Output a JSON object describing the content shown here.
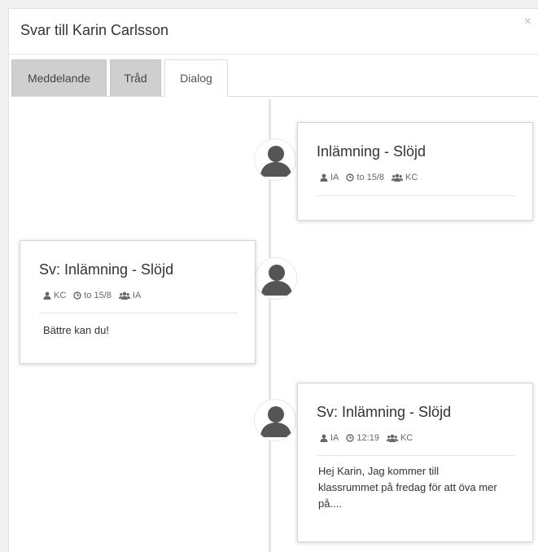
{
  "modal": {
    "title": "Svar till Karin Carlsson",
    "close_label": "×"
  },
  "tabs": [
    {
      "label": "Meddelande",
      "active": false
    },
    {
      "label": "Tråd",
      "active": false
    },
    {
      "label": "Dialog",
      "active": true
    }
  ],
  "timeline": [
    {
      "side": "right",
      "title": "Inlämning - Slöjd",
      "sender": "IA",
      "time": "to 15/8",
      "recipient": "KC",
      "body": ""
    },
    {
      "side": "left",
      "title": "Sv: Inlämning - Slöjd",
      "sender": "KC",
      "time": "to 15/8",
      "recipient": "IA",
      "body": "Bättre kan du!"
    },
    {
      "side": "right",
      "title": "Sv: Inlämning - Slöjd",
      "sender": "IA",
      "time": "12:19",
      "recipient": "KC",
      "body": "Hej Karin, Jag kommer till klassrummet på fredag för att öva mer på...."
    }
  ],
  "icons": {
    "sender": "user-icon",
    "time": "clock-icon",
    "recipient": "users-icon",
    "avatar": "avatar-placeholder-icon"
  },
  "colors": {
    "tab_inactive_bg": "#cfcfcf",
    "avatar_fill": "#555555",
    "timeline_line": "#e6e6e6"
  }
}
